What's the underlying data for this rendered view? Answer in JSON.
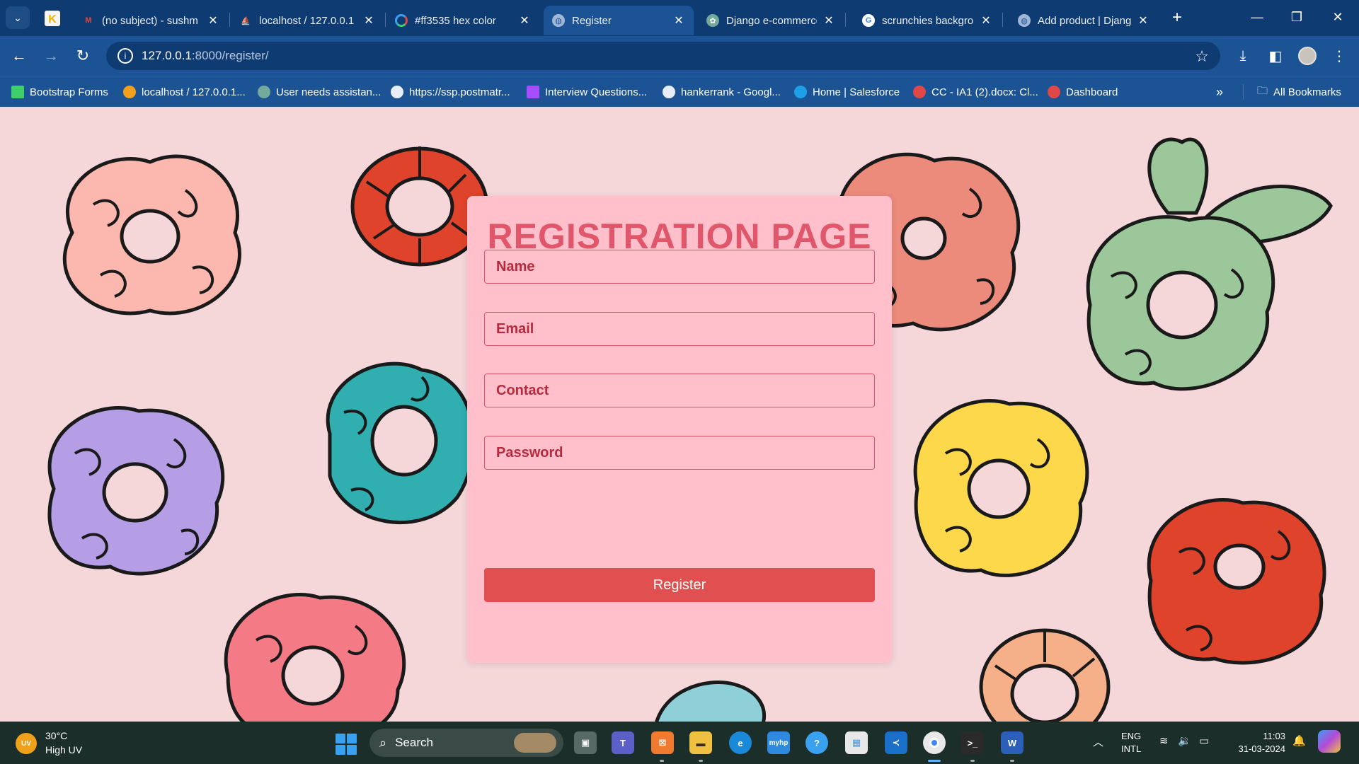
{
  "browser": {
    "tabs": [
      {
        "title": "(no subject) - sushm",
        "favicon": "gmail-icon",
        "color": "#ea4335"
      },
      {
        "title": "localhost / 127.0.0.1",
        "favicon": "phpmyadmin-icon",
        "color": "#f0a019"
      },
      {
        "title": "#ff3535 hex color",
        "favicon": "colorhexa-icon",
        "color": "#3aa0f0"
      },
      {
        "title": "Register",
        "favicon": "globe-icon",
        "color": "#9fb6d6",
        "active": true
      },
      {
        "title": "Django e-commerce",
        "favicon": "chatgpt-icon",
        "color": "#74aa9c"
      },
      {
        "title": "scrunchies backgrou",
        "favicon": "google-icon",
        "color": "#ffffff"
      },
      {
        "title": "Add product | Djang",
        "favicon": "globe-icon",
        "color": "#9fb6d6"
      }
    ],
    "new_tab": "+",
    "url_host": "127.0.0.1",
    "url_rest": ":8000/register/",
    "bookmarks": [
      {
        "label": "Bootstrap Forms",
        "color": "#3ccf6b"
      },
      {
        "label": "localhost / 127.0.0.1...",
        "color": "#f0a019"
      },
      {
        "label": "User needs assistan...",
        "color": "#74aa9c"
      },
      {
        "label": "https://ssp.postmatr...",
        "color": "#e8eef7"
      },
      {
        "label": "Interview Questions...",
        "color": "#a64dff"
      },
      {
        "label": "hankerrank - Googl...",
        "color": "#e8eef7"
      },
      {
        "label": "Home | Salesforce",
        "color": "#1ea0e8"
      },
      {
        "label": "CC - IA1 (2).docx: Cl...",
        "color": "#e04848"
      },
      {
        "label": "Dashboard",
        "color": "#e04848"
      }
    ],
    "all_bookmarks": "All Bookmarks"
  },
  "form": {
    "title": "REGISTRATION PAGE",
    "name_placeholder": "Name",
    "email_placeholder": "Email",
    "contact_placeholder": "Contact",
    "password_placeholder": "Password",
    "submit_label": "Register"
  },
  "taskbar": {
    "weather_badge": "UV",
    "temp": "30°C",
    "weather": "High UV",
    "search": "Search",
    "lang_line1": "ENG",
    "lang_line2": "INTL",
    "time": "11:03",
    "date": "31-03-2024"
  },
  "colors": {
    "page_bg": "#f5d7da",
    "card_bg": "#ffc0cb",
    "title": "#e0566a",
    "button": "#e05050"
  }
}
